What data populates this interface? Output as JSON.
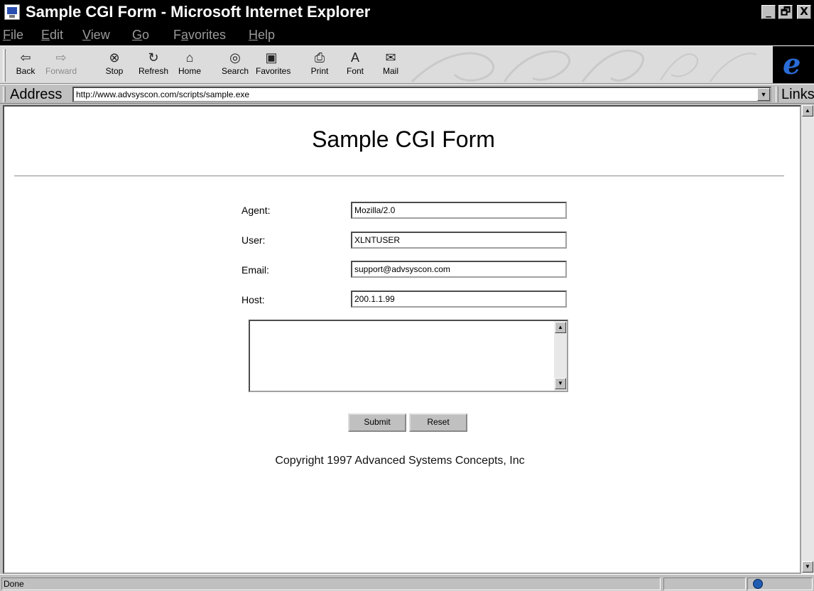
{
  "window": {
    "title": "Sample CGI Form - Microsoft Internet Explorer",
    "controls": {
      "minimize": "_",
      "maximize": "🗗",
      "close": "X"
    }
  },
  "menu": {
    "items": [
      {
        "accel": "F",
        "rest": "ile"
      },
      {
        "accel": "E",
        "rest": "dit"
      },
      {
        "accel": "V",
        "rest": "iew"
      },
      {
        "accel": "G",
        "rest": "o"
      },
      {
        "pre": "F",
        "accel": "a",
        "rest": "vorites"
      },
      {
        "accel": "H",
        "rest": "elp"
      }
    ]
  },
  "toolbar": {
    "buttons": [
      {
        "label": "Back",
        "icon": "⇦"
      },
      {
        "label": "Forward",
        "icon": "⇨"
      },
      {
        "label": "Stop",
        "icon": "⊗"
      },
      {
        "label": "Refresh",
        "icon": "↻"
      },
      {
        "label": "Home",
        "icon": "⌂"
      },
      {
        "label": "Search",
        "icon": "◎"
      },
      {
        "label": "Favorites",
        "icon": "▣"
      },
      {
        "label": "Print",
        "icon": "⎙"
      },
      {
        "label": "Font",
        "icon": "A"
      },
      {
        "label": "Mail",
        "icon": "✉"
      }
    ],
    "logo": "e"
  },
  "address": {
    "label": "Address",
    "url": "http://www.advsyscon.com/scripts/sample.exe",
    "links_label": "Links"
  },
  "page": {
    "title": "Sample CGI Form",
    "fields": [
      {
        "label": "Agent:",
        "value": "Mozilla/2.0"
      },
      {
        "label": "User:",
        "value": "XLNTUSER"
      },
      {
        "label": "Email:",
        "value": "support@advsyscon.com"
      },
      {
        "label": "Host:",
        "value": "200.1.1.99"
      }
    ],
    "comments": "",
    "submit_label": "Submit",
    "reset_label": "Reset",
    "copyright": "Copyright 1997 Advanced Systems Concepts, Inc"
  },
  "status": {
    "text": "Done"
  }
}
